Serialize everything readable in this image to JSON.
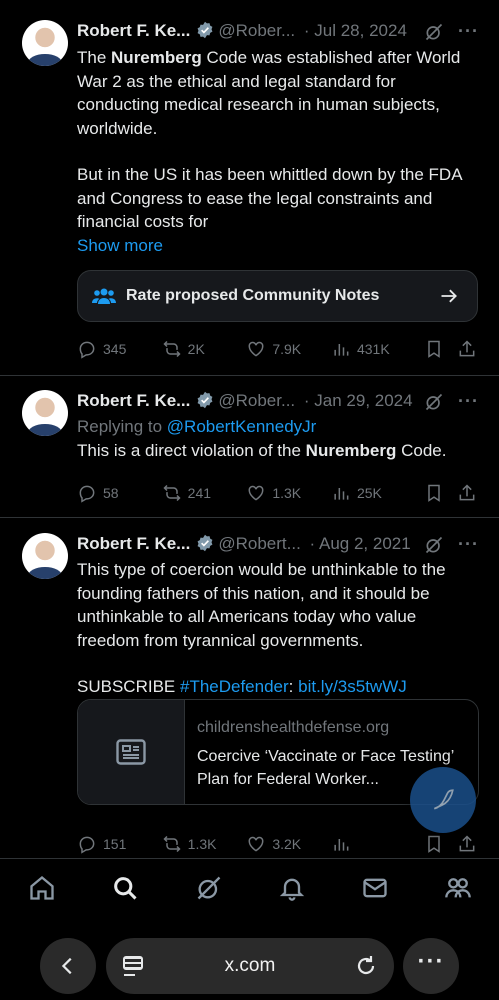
{
  "tweets": [
    {
      "author_name": "Robert F. Ke...",
      "handle": "@Rober...",
      "date": "· Jul 28, 2024",
      "text_p1_a": "The ",
      "text_p1_b": "Nuremberg",
      "text_p1_c": " Code was established after World War 2 as the ethical and  legal standard for conducting medical research in human subjects, worldwide.",
      "text_p2": "But in the US  it has been whittled down by the FDA and Congress to ease the legal  constraints and financial costs for",
      "show_more": "Show more",
      "community_notes_label": "Rate proposed Community Notes",
      "replies": "345",
      "reposts": "2K",
      "likes": "7.9K",
      "views": "431K"
    },
    {
      "author_name": "Robert F. Ke...",
      "handle": "@Rober...",
      "date": "· Jan 29, 2024",
      "replying_prefix": "Replying to ",
      "replying_handle": "@RobertKennedyJr",
      "text_a": "This is a direct violation of the ",
      "text_b": "Nuremberg",
      "text_c": " Code.",
      "replies": "58",
      "reposts": "241",
      "likes": "1.3K",
      "views": "25K"
    },
    {
      "author_name": "Robert F. Ke...",
      "handle": "@Robert...",
      "date": "· Aug 2, 2021",
      "text_p1": "This type of coercion would be unthinkable to the founding fathers of this nation, and it should be unthinkable to all Americans today who value freedom from tyrannical governments.",
      "subscribe": "SUBSCRIBE ",
      "hashtag": "#TheDefender",
      "colon": ": ",
      "short_link": "bit.ly/3s5twWJ",
      "card_domain": "childrenshealthdefense.org",
      "card_title": "Coercive ‘Vaccinate or Face Testing’ Plan for Federal Worker...",
      "replies": "151",
      "reposts": "1.3K",
      "likes": "3.2K"
    }
  ],
  "browser": {
    "url": "x.com"
  },
  "colors": {
    "accent": "#1d9bf0",
    "muted": "#71767b",
    "background": "#000000",
    "border": "#2f3336"
  },
  "icons": {
    "tabbar": [
      "home-icon",
      "search-icon",
      "grok-icon",
      "notifications-icon",
      "messages-icon",
      "communities-icon"
    ],
    "browser": [
      "back-icon",
      "reader-icon",
      "reload-icon",
      "more-icon"
    ]
  }
}
